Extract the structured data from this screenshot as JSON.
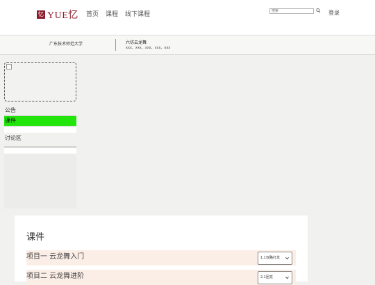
{
  "header": {
    "logo_mark": "忆",
    "logo_text": "YUE忆",
    "nav": [
      "首页",
      "课程",
      "线下课程"
    ],
    "search_placeholder": "搜索",
    "login": "登录"
  },
  "course": {
    "school": "广东技术师范大学",
    "title": "六坊云龙舞",
    "members": "xxx、xxx、xxx、xxx、xxx"
  },
  "sidebar": {
    "items": [
      "公告",
      "课件",
      "讨论区"
    ],
    "active_index": 1,
    "active_color": "#22e60b"
  },
  "main": {
    "section_title": "课件",
    "rows": [
      {
        "label": "项目一 云龙舞入门",
        "selected": "1.1双路打龙"
      },
      {
        "label": "项目二 云龙舞进阶",
        "selected": "2.1团龙"
      }
    ]
  },
  "colors": {
    "brand": "#8b1a2b",
    "row_bg": "#fbeee6"
  },
  "icons": {
    "search": "search-icon",
    "select_arrow": "chevron-down-icon"
  }
}
